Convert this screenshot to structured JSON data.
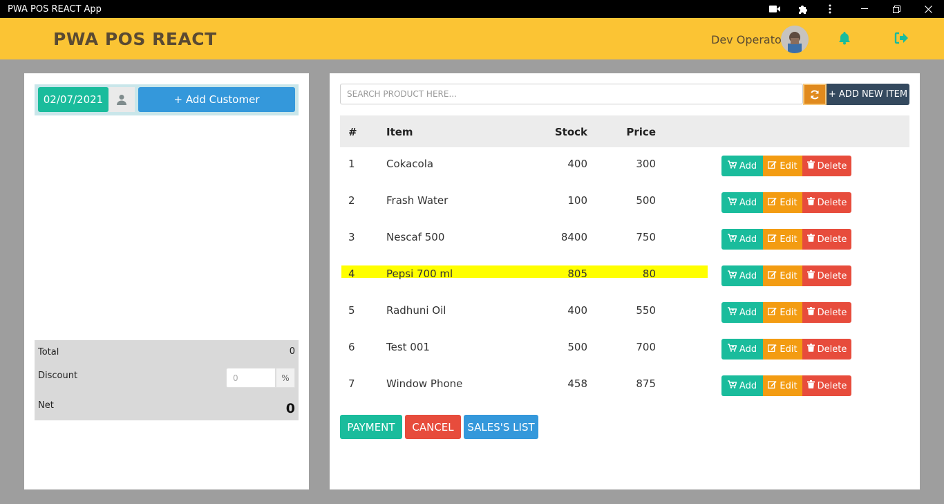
{
  "window": {
    "title": "PWA POS REACT App"
  },
  "header": {
    "brand": "PWA POS REACT",
    "operator": "Dev Operator"
  },
  "customer": {
    "date": "02/07/2021",
    "add_label": "+ Add Customer"
  },
  "totals": {
    "total_label": "Total",
    "total_value": "0",
    "discount_label": "Discount",
    "discount_placeholder": "0",
    "discount_unit": "%",
    "net_label": "Net",
    "net_value": "0"
  },
  "search": {
    "placeholder": "SEARCH PRODUCT HERE...",
    "add_item_label": "+ ADD NEW ITEM"
  },
  "table": {
    "headers": {
      "num": "#",
      "item": "Item",
      "stock": "Stock",
      "price": "Price"
    },
    "actions": {
      "add": "Add",
      "edit": "Edit",
      "delete": "Delete"
    },
    "rows": [
      {
        "num": "1",
        "item": "Cokacola",
        "stock": "400",
        "price": "300"
      },
      {
        "num": "2",
        "item": "Frash Water",
        "stock": "100",
        "price": "500"
      },
      {
        "num": "3",
        "item": "Nescaf 500",
        "stock": "8400",
        "price": "750"
      },
      {
        "num": "4",
        "item": "Pepsi 700 ml",
        "stock": "805",
        "price": "80"
      },
      {
        "num": "5",
        "item": "Radhuni Oil",
        "stock": "400",
        "price": "550"
      },
      {
        "num": "6",
        "item": "Test 001",
        "stock": "500",
        "price": "700"
      },
      {
        "num": "7",
        "item": "Window Phone",
        "stock": "458",
        "price": "875"
      }
    ],
    "highlighted_row": 4
  },
  "footer_buttons": {
    "payment": "PAYMENT",
    "cancel": "CANCEL",
    "sales_list": "SALES'S LIST"
  },
  "colors": {
    "header_bg": "#fbc434",
    "primary_green": "#1abc9c",
    "orange": "#f39c12",
    "red": "#e74c3c",
    "blue": "#3498db",
    "dark": "#34495e",
    "highlight": "#ffff00"
  },
  "icons": {
    "titlebar": [
      "video-camera-icon",
      "puzzle-extension-icon",
      "kebab-menu-icon",
      "minimize-icon",
      "restore-icon",
      "close-icon"
    ],
    "header": [
      "bell-icon",
      "sign-out-icon"
    ],
    "customer": "user-icon",
    "search": "refresh-icon",
    "actions": [
      "cart-plus-icon",
      "edit-icon",
      "trash-icon"
    ]
  }
}
